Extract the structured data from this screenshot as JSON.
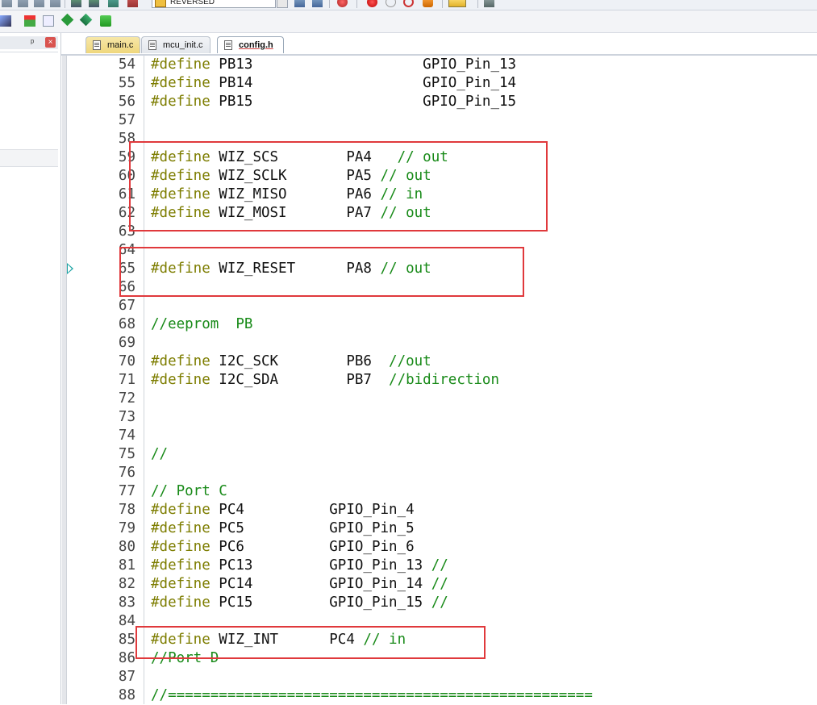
{
  "toolbar": {
    "combo_value": "REVERSED"
  },
  "tabs": [
    {
      "label": "main.c"
    },
    {
      "label": "mcu_init.c"
    },
    {
      "label": "config.h"
    }
  ],
  "panel": {
    "pin": "ᵖ",
    "close": "×"
  },
  "lines": [
    {
      "n": "54",
      "kw": "#define",
      "rest": " PB13                    GPIO_Pin_13",
      "cm": ""
    },
    {
      "n": "55",
      "kw": "#define",
      "rest": " PB14                    GPIO_Pin_14",
      "cm": ""
    },
    {
      "n": "56",
      "kw": "#define",
      "rest": " PB15                    GPIO_Pin_15",
      "cm": ""
    },
    {
      "n": "57",
      "kw": "",
      "rest": "",
      "cm": ""
    },
    {
      "n": "58",
      "kw": "",
      "rest": "",
      "cm": ""
    },
    {
      "n": "59",
      "kw": "#define",
      "rest": " WIZ_SCS        PA4   ",
      "cm": "// out"
    },
    {
      "n": "60",
      "kw": "#define",
      "rest": " WIZ_SCLK       PA5 ",
      "cm": "// out"
    },
    {
      "n": "61",
      "kw": "#define",
      "rest": " WIZ_MISO       PA6 ",
      "cm": "// in"
    },
    {
      "n": "62",
      "kw": "#define",
      "rest": " WIZ_MOSI       PA7 ",
      "cm": "// out"
    },
    {
      "n": "63",
      "kw": "",
      "rest": "",
      "cm": ""
    },
    {
      "n": "64",
      "kw": "",
      "rest": "",
      "cm": ""
    },
    {
      "n": "65",
      "kw": "#define",
      "rest": " WIZ_RESET      PA8 ",
      "cm": "// out"
    },
    {
      "n": "66",
      "kw": "",
      "rest": "",
      "cm": ""
    },
    {
      "n": "67",
      "kw": "",
      "rest": "",
      "cm": ""
    },
    {
      "n": "68",
      "kw": "",
      "rest": "",
      "cm": "//eeprom  PB"
    },
    {
      "n": "69",
      "kw": "",
      "rest": "",
      "cm": ""
    },
    {
      "n": "70",
      "kw": "#define",
      "rest": " I2C_SCK        PB6  ",
      "cm": "//out"
    },
    {
      "n": "71",
      "kw": "#define",
      "rest": " I2C_SDA        PB7  ",
      "cm": "//bidirection"
    },
    {
      "n": "72",
      "kw": "",
      "rest": "",
      "cm": ""
    },
    {
      "n": "73",
      "kw": "",
      "rest": "",
      "cm": ""
    },
    {
      "n": "74",
      "kw": "",
      "rest": "",
      "cm": ""
    },
    {
      "n": "75",
      "kw": "",
      "rest": "",
      "cm": "//"
    },
    {
      "n": "76",
      "kw": "",
      "rest": "",
      "cm": ""
    },
    {
      "n": "77",
      "kw": "",
      "rest": "",
      "cm": "// Port C"
    },
    {
      "n": "78",
      "kw": "#define",
      "rest": " PC4          GPIO_Pin_4",
      "cm": ""
    },
    {
      "n": "79",
      "kw": "#define",
      "rest": " PC5          GPIO_Pin_5",
      "cm": ""
    },
    {
      "n": "80",
      "kw": "#define",
      "rest": " PC6          GPIO_Pin_6",
      "cm": ""
    },
    {
      "n": "81",
      "kw": "#define",
      "rest": " PC13         GPIO_Pin_13 ",
      "cm": "//"
    },
    {
      "n": "82",
      "kw": "#define",
      "rest": " PC14         GPIO_Pin_14 ",
      "cm": "//"
    },
    {
      "n": "83",
      "kw": "#define",
      "rest": " PC15         GPIO_Pin_15 ",
      "cm": "//"
    },
    {
      "n": "84",
      "kw": "",
      "rest": "",
      "cm": ""
    },
    {
      "n": "85",
      "kw": "#define",
      "rest": " WIZ_INT      PC4 ",
      "cm": "// in"
    },
    {
      "n": "86",
      "kw": "",
      "rest": "",
      "cm": "//Port D"
    },
    {
      "n": "87",
      "kw": "",
      "rest": "",
      "cm": ""
    },
    {
      "n": "88",
      "kw": "",
      "rest": "",
      "cm": "//=================================================="
    }
  ],
  "colors": {
    "keyword": "#7d7d00",
    "comment": "#188a18",
    "highlight_box": "#e0393c",
    "marker": "#1aa3a3"
  }
}
